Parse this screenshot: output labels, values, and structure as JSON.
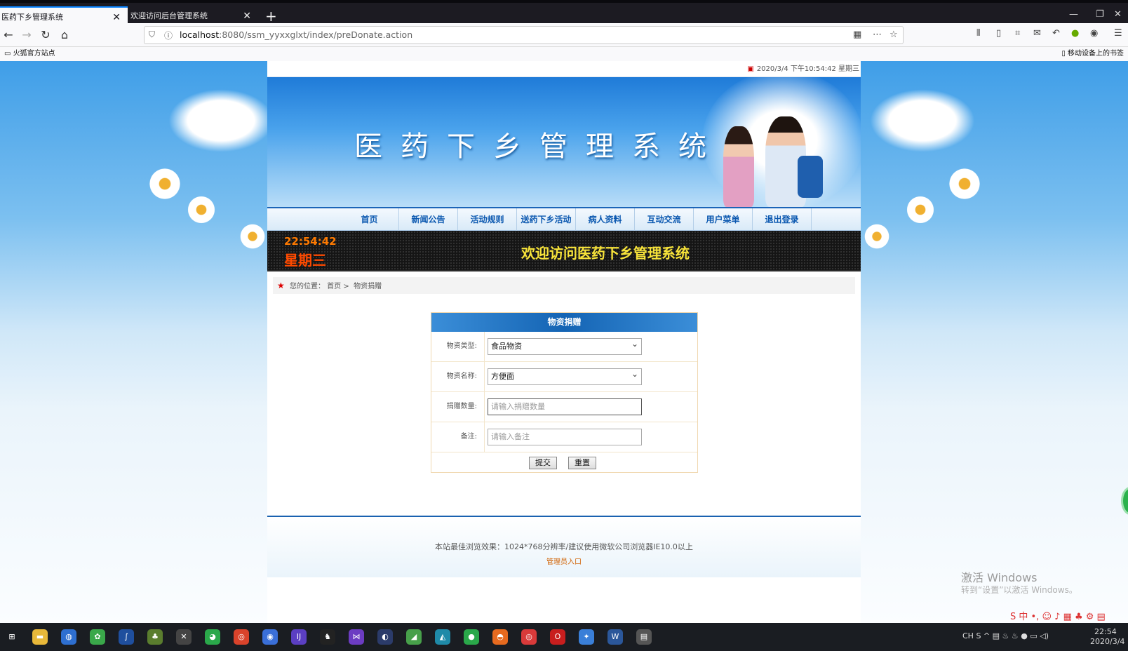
{
  "browser": {
    "tabs": [
      {
        "label": "医药下乡管理系统",
        "active": true
      },
      {
        "label": "欢迎访问后台管理系统",
        "active": false
      }
    ],
    "url_host": "localhost",
    "url_rest": ":8080/ssm_yyxxglxt/index/preDonate.action",
    "bookmark": "火狐官方站点",
    "mobile_bookmark": "移动设备上的书签"
  },
  "site": {
    "datetime": "2020/3/4 下午10:54:42 星期三",
    "title": "医药下乡管理系统",
    "menu": [
      "首页",
      "新闻公告",
      "活动规则",
      "送药下乡活动",
      "病人资料",
      "互动交流",
      "用户菜单",
      "退出登录"
    ],
    "led_time": "22:54:42",
    "led_week": "星期三",
    "led_message": "欢迎访问医药下乡管理系统",
    "breadcrumb": {
      "prefix": "您的位置：",
      "home": "首页",
      "sep": " > ",
      "current": "物资捐赠"
    }
  },
  "form": {
    "title": "物资捐赠",
    "fields": [
      {
        "label": "物资类型:",
        "value": "食品物资",
        "type": "select"
      },
      {
        "label": "物资名称:",
        "value": "方便面",
        "type": "select"
      },
      {
        "label": "捐赠数量:",
        "placeholder": "请输入捐赠数量",
        "type": "input"
      },
      {
        "label": "备注:",
        "placeholder": "请输入备注",
        "type": "input"
      }
    ],
    "submit": "提交",
    "reset": "重置"
  },
  "footer": {
    "line1": "本站最佳浏览效果：1024*768分辨率/建议使用微软公司浏览器IE10.0以上",
    "admin_link": "管理员入口"
  },
  "os": {
    "watermark1": "激活 Windows",
    "watermark2": "转到“设置”以激活 Windows。",
    "clock_time": "22:54",
    "clock_date": "2020/3/4"
  },
  "colors": {
    "accent": "#1464b4",
    "led_orange": "#ff7a00",
    "led_yellow": "#f7e33a"
  }
}
